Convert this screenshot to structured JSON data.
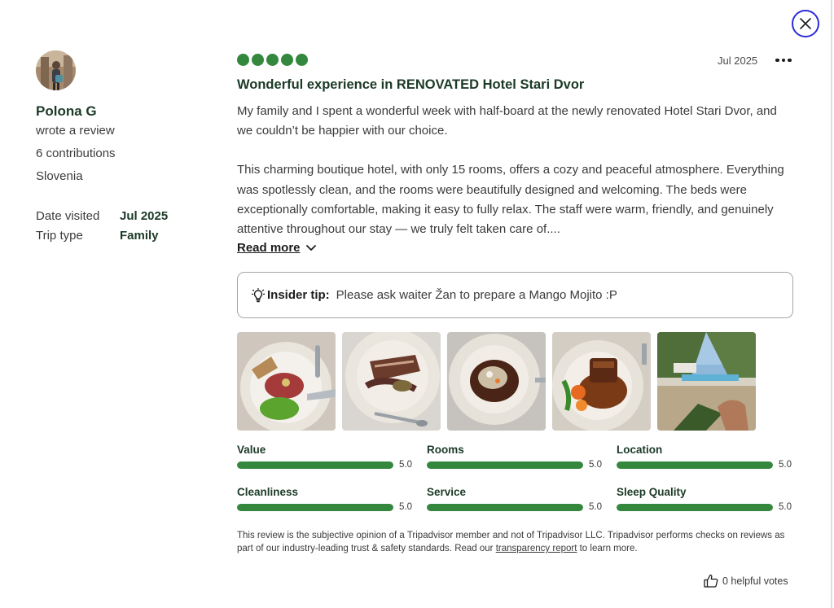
{
  "reviewer": {
    "name": "Polona G",
    "action": "wrote a review",
    "contributions": "6 contributions",
    "location": "Slovenia",
    "details": [
      {
        "label": "Date visited",
        "value": "Jul 2025"
      },
      {
        "label": "Trip type",
        "value": "Family"
      }
    ]
  },
  "review": {
    "rating": 5,
    "date": "Jul 2025",
    "title": "Wonderful experience in RENOVATED Hotel Stari Dvor",
    "paragraphs": [
      "My family and I spent a wonderful week with half-board at the newly renovated Hotel Stari Dvor, and we couldn’t be happier with our choice.",
      "This charming boutique hotel, with only 15 rooms, offers a cozy and peaceful atmosphere. Everything was spotlessly clean, and the rooms were beautifully designed and welcoming. The beds were exceptionally comfortable, making it easy to fully relax. The staff were warm, friendly, and genuinely attentive throughout our stay — we truly felt taken care of...."
    ],
    "read_more": "Read more"
  },
  "tip": {
    "label": "Insider tip:",
    "text": "Please ask waiter Žan to prepare a Mango Mojito :P"
  },
  "photos": [
    "photo-tartare",
    "photo-sliced-meat",
    "photo-risotto",
    "photo-pork-belly",
    "photo-poolside"
  ],
  "ratings": [
    {
      "label": "Value",
      "value": "5.0",
      "fraction": 1.0
    },
    {
      "label": "Rooms",
      "value": "5.0",
      "fraction": 1.0
    },
    {
      "label": "Location",
      "value": "5.0",
      "fraction": 1.0
    },
    {
      "label": "Cleanliness",
      "value": "5.0",
      "fraction": 1.0
    },
    {
      "label": "Service",
      "value": "5.0",
      "fraction": 1.0
    },
    {
      "label": "Sleep Quality",
      "value": "5.0",
      "fraction": 1.0
    }
  ],
  "disclaimer": {
    "text_before": "This review is the subjective opinion of a Tripadvisor member and not of Tripadvisor LLC. Tripadvisor performs checks on reviews as part of our industry-leading trust & safety standards. Read our ",
    "link": "transparency report",
    "text_after": " to learn more."
  },
  "helpful": {
    "label": "0 helpful votes"
  },
  "icons": {
    "close": "close-icon",
    "more": "more-icon",
    "chevron": "chevron-down-icon",
    "tip": "lightbulb-icon",
    "helpful": "thumbs-up-icon"
  },
  "colors": {
    "accent": "#34883e",
    "close_ring": "#2e2bdc",
    "heading": "#1c3a28"
  }
}
